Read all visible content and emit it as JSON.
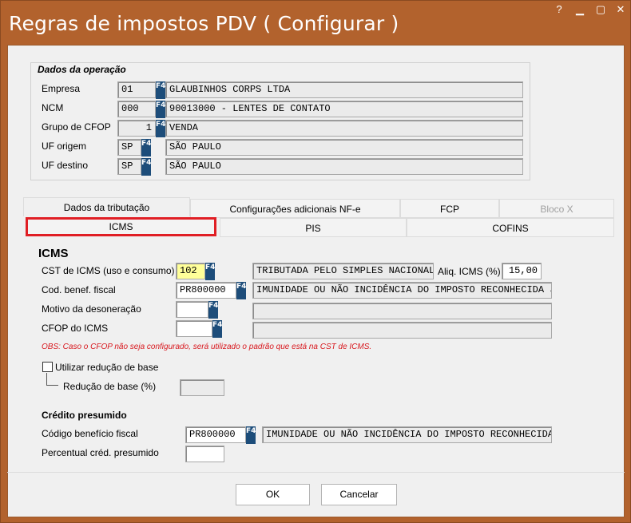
{
  "window": {
    "title": "Regras de impostos PDV ( Configurar )",
    "help_label": "?",
    "min_label": "▁",
    "max_label": "▢",
    "close_label": "✕"
  },
  "operation": {
    "legend": "Dados da operação",
    "empresa": {
      "label": "Empresa",
      "code": "01",
      "desc": "GLAUBINHOS CORPS LTDA"
    },
    "ncm": {
      "label": "NCM",
      "code": "000",
      "desc": "90013000 - LENTES DE CONTATO"
    },
    "cfop_group": {
      "label": "Grupo de CFOP",
      "code": "1",
      "desc": "VENDA"
    },
    "uf_origem": {
      "label": "UF origem",
      "code": "SP",
      "desc": "SÃO PAULO"
    },
    "uf_destino": {
      "label": "UF destino",
      "code": "SP",
      "desc": "SÃO PAULO"
    }
  },
  "f4_label": "F4",
  "tabs": [
    {
      "label": "Dados da tributação"
    },
    {
      "label": "Configurações adicionais NF-e"
    },
    {
      "label": "FCP"
    },
    {
      "label": "Bloco X"
    }
  ],
  "subtabs": [
    {
      "label": "ICMS"
    },
    {
      "label": "PIS"
    },
    {
      "label": "COFINS"
    }
  ],
  "icms": {
    "title": "ICMS",
    "cst": {
      "label": "CST de ICMS (uso e consumo)",
      "code": "102",
      "desc": "TRIBUTADA PELO SIMPLES NACIONAL"
    },
    "aliq": {
      "label": "Aliq. ICMS (%)",
      "value": "15,00"
    },
    "benef": {
      "label": "Cod. benef. fiscal",
      "code": "PR800000",
      "desc": "IMUNIDADE OU NÃO INCIDÊNCIA DO IMPOSTO RECONHECIDA JUD"
    },
    "motivo": {
      "label": "Motivo da desoneração",
      "code": "",
      "desc": ""
    },
    "cfop": {
      "label": "CFOP do ICMS",
      "code": "",
      "desc": ""
    },
    "obs": "OBS: Caso o CFOP não seja configurado, será utilizado o padrão que está na CST de ICMS.",
    "reducao_check": {
      "label": "Utilizar redução de base",
      "checked": false
    },
    "reducao": {
      "label": "Redução de base (%)",
      "value": ""
    }
  },
  "credito": {
    "title": "Crédito presumido",
    "codigo": {
      "label": "Código benefício fiscal",
      "code": "PR800000",
      "desc": "IMUNIDADE OU NÃO INCIDÊNCIA DO IMPOSTO RECONHECIDA"
    },
    "percentual": {
      "label": "Percentual créd. presumido",
      "value": ""
    }
  },
  "buttons": {
    "ok": "OK",
    "cancel": "Cancelar"
  }
}
